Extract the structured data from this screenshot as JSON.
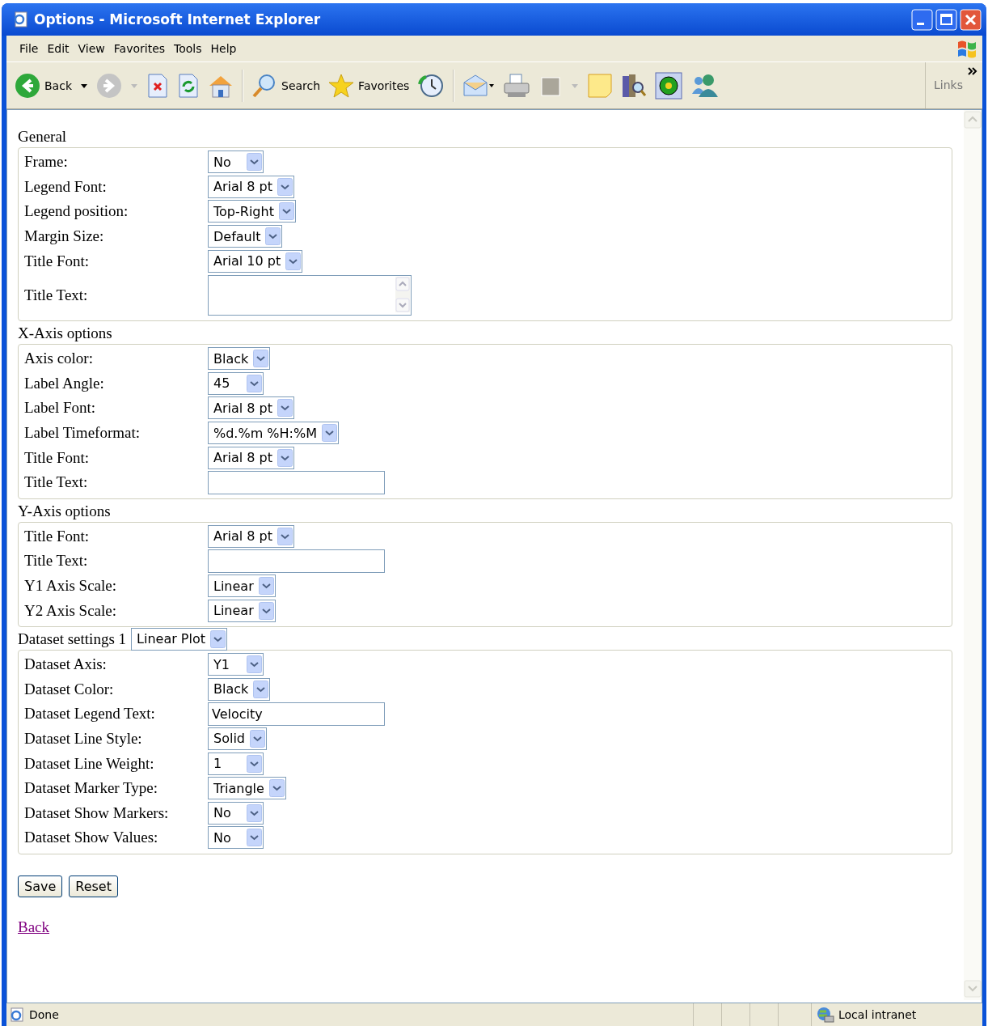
{
  "window": {
    "title": "Options - Microsoft Internet Explorer"
  },
  "menu": [
    "File",
    "Edit",
    "View",
    "Favorites",
    "Tools",
    "Help"
  ],
  "toolbar": {
    "back": "Back",
    "search": "Search",
    "favorites": "Favorites",
    "links": "Links"
  },
  "sections": [
    {
      "title": "General",
      "rows": [
        {
          "label": "Frame:",
          "kind": "select",
          "value": "No"
        },
        {
          "label": "Legend Font:",
          "kind": "select",
          "value": "Arial 8 pt"
        },
        {
          "label": "Legend position:",
          "kind": "select",
          "value": "Top-Right"
        },
        {
          "label": "Margin Size:",
          "kind": "select",
          "value": "Default"
        },
        {
          "label": "Title Font:",
          "kind": "select",
          "value": "Arial 10 pt"
        },
        {
          "label": "Title Text:",
          "kind": "textarea"
        }
      ]
    },
    {
      "title": "X-Axis options",
      "rows": [
        {
          "label": "Axis color:",
          "kind": "select",
          "value": "Black"
        },
        {
          "label": "Label Angle:",
          "kind": "select",
          "value": "45"
        },
        {
          "label": "Label Font:",
          "kind": "select",
          "value": "Arial 8 pt"
        },
        {
          "label": "Label Timeformat:",
          "kind": "select",
          "value": "%d.%m %H:%M"
        },
        {
          "label": "Title Font:",
          "kind": "select",
          "value": "Arial 8 pt"
        },
        {
          "label": "Title Text:",
          "kind": "input"
        }
      ]
    },
    {
      "title": "Y-Axis options",
      "rows": [
        {
          "label": "Title Font:",
          "kind": "select",
          "value": "Arial 8 pt"
        },
        {
          "label": "Title Text:",
          "kind": "input"
        },
        {
          "label": "Y1 Axis Scale:",
          "kind": "select",
          "value": "Linear"
        },
        {
          "label": "Y2 Axis Scale:",
          "kind": "select",
          "value": "Linear"
        }
      ]
    },
    {
      "title": "Dataset settings 1",
      "title_select": "Linear Plot",
      "rows": [
        {
          "label": "Dataset Axis:",
          "kind": "select",
          "value": "Y1"
        },
        {
          "label": "Dataset Color:",
          "kind": "select",
          "value": "Black"
        },
        {
          "label": "Dataset Legend Text:",
          "kind": "input",
          "value": "Velocity"
        },
        {
          "label": "Dataset Line Style:",
          "kind": "select",
          "value": "Solid"
        },
        {
          "label": "Dataset Line Weight:",
          "kind": "select",
          "value": "1"
        },
        {
          "label": "Dataset Marker Type:",
          "kind": "select",
          "value": "Triangle"
        },
        {
          "label": "Dataset Show Markers:",
          "kind": "select",
          "value": "No"
        },
        {
          "label": "Dataset Show Values:",
          "kind": "select",
          "value": "No"
        }
      ]
    }
  ],
  "buttons": [
    "Save",
    "Reset"
  ],
  "link": "Back",
  "status_bar": {
    "text": "Done",
    "zone": "Local intranet"
  }
}
